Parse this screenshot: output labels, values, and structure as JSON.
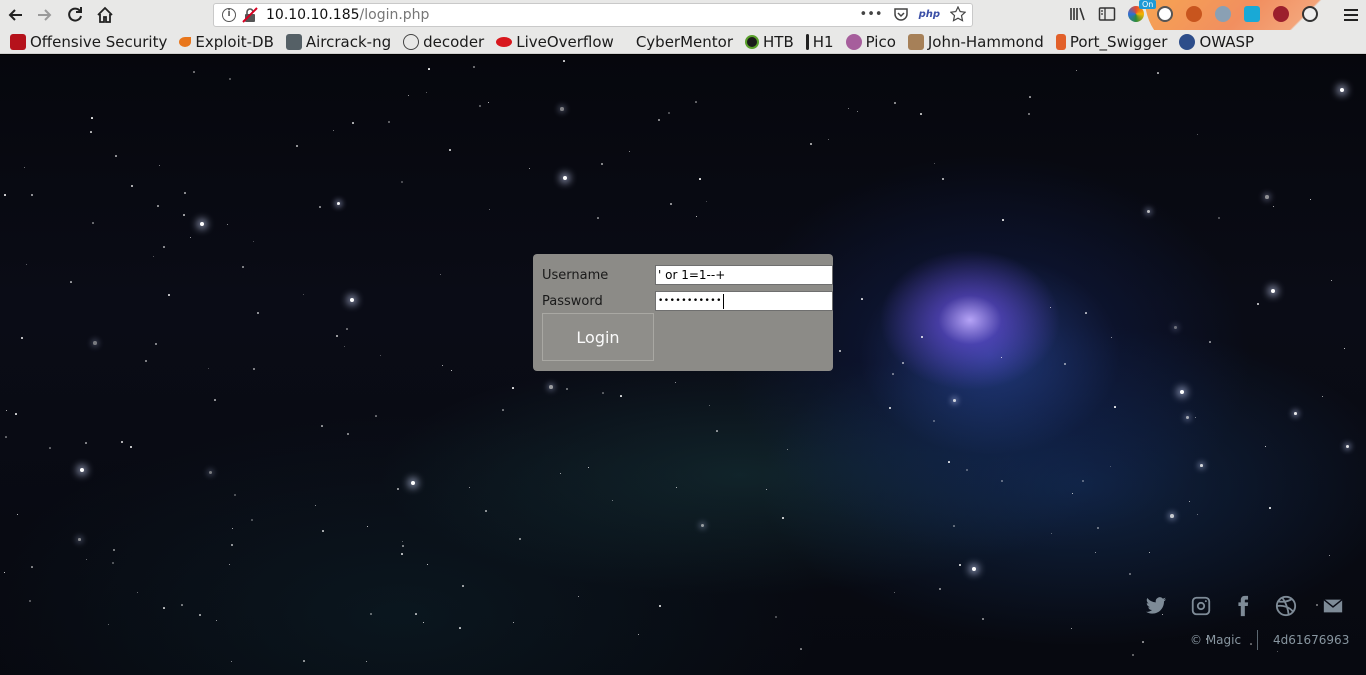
{
  "browser": {
    "url_host": "10.10.10.185",
    "url_path": "/login.php",
    "url_more": "•••",
    "php_badge": "php",
    "on_badge": "On",
    "nav_icons": [
      "back-arrow-icon",
      "forward-arrow-icon",
      "reload-icon",
      "home-icon"
    ],
    "toolbar_icons": [
      "library-icon",
      "sidebar-icon",
      "extension-icon",
      "account-icon",
      "extension-icon",
      "extension-icon",
      "extension-icon",
      "menu-icon"
    ]
  },
  "bookmarks": [
    {
      "label": "Offensive Security",
      "icon": "offsec-icon",
      "color": "#b5121b"
    },
    {
      "label": "Exploit-DB",
      "icon": "exploitdb-icon",
      "color": "#e8761c"
    },
    {
      "label": "Aircrack-ng",
      "icon": "aircrack-icon",
      "color": "#556066"
    },
    {
      "label": "decoder",
      "icon": "globe-icon",
      "color": "#444444"
    },
    {
      "label": "LiveOverflow",
      "icon": "liveoverflow-icon",
      "color": "#d8171d"
    },
    {
      "label": "CyberMentor",
      "icon": "blank-icon",
      "color": "#e8e8e7"
    },
    {
      "label": "HTB",
      "icon": "htb-icon",
      "color": "#2f6b23"
    },
    {
      "label": "H1",
      "icon": "h1-icon",
      "color": "#222222"
    },
    {
      "label": "Pico",
      "icon": "pico-icon",
      "color": "#a65e9c"
    },
    {
      "label": "John-Hammond",
      "icon": "john-hammond-icon",
      "color": "#a68058"
    },
    {
      "label": "Port_Swigger",
      "icon": "portswigger-icon",
      "color": "#e2602a"
    },
    {
      "label": "OWASP",
      "icon": "owasp-icon",
      "color": "#2d4d8a"
    }
  ],
  "login": {
    "username_label": "Username",
    "password_label": "Password",
    "username_value": "' or 1=1--+",
    "password_value": "•••••••••••",
    "login_button": "Login"
  },
  "footer": {
    "copyright": "© Magic",
    "code": "4d61676963",
    "social_icons": [
      "twitter-icon",
      "instagram-icon",
      "facebook-icon",
      "dribbble-icon",
      "mail-icon"
    ]
  }
}
